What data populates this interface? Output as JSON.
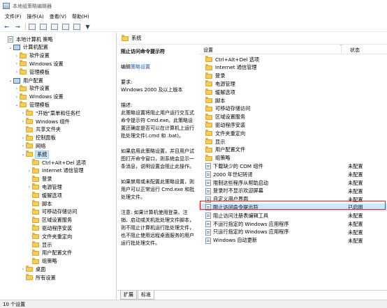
{
  "window": {
    "title": "本地组策略编辑器"
  },
  "menu": [
    "文件(F)",
    "操作(A)",
    "查看(V)",
    "帮助(H)"
  ],
  "tree": [
    {
      "label": "本地计算机 策略",
      "indent": 0,
      "twisty": "",
      "icon": "doc"
    },
    {
      "label": "计算机配置",
      "indent": 1,
      "twisty": "v",
      "icon": "pc"
    },
    {
      "label": "软件设置",
      "indent": 2,
      "twisty": ">",
      "icon": "folder"
    },
    {
      "label": "Windows 设置",
      "indent": 2,
      "twisty": ">",
      "icon": "folder"
    },
    {
      "label": "管理模板",
      "indent": 2,
      "twisty": ">",
      "icon": "folder"
    },
    {
      "label": "用户配置",
      "indent": 1,
      "twisty": "v",
      "icon": "pc"
    },
    {
      "label": "软件设置",
      "indent": 2,
      "twisty": ">",
      "icon": "folder"
    },
    {
      "label": "Windows 设置",
      "indent": 2,
      "twisty": ">",
      "icon": "folder"
    },
    {
      "label": "管理模板",
      "indent": 2,
      "twisty": "v",
      "icon": "folder"
    },
    {
      "label": "\"开始\"菜单和任务栏",
      "indent": 3,
      "twisty": ">",
      "icon": "folder"
    },
    {
      "label": "Windows 组件",
      "indent": 3,
      "twisty": ">",
      "icon": "folder"
    },
    {
      "label": "共享文件夹",
      "indent": 3,
      "twisty": "",
      "icon": "folder"
    },
    {
      "label": "控制面板",
      "indent": 3,
      "twisty": ">",
      "icon": "folder"
    },
    {
      "label": "网络",
      "indent": 3,
      "twisty": ">",
      "icon": "folder"
    },
    {
      "label": "系统",
      "indent": 3,
      "twisty": "v",
      "icon": "folder",
      "selected": true
    },
    {
      "label": "Ctrl+Alt+Del 选项",
      "indent": 4,
      "twisty": "",
      "icon": "folder"
    },
    {
      "label": "Internet 通信管理",
      "indent": 4,
      "twisty": ">",
      "icon": "folder"
    },
    {
      "label": "登录",
      "indent": 4,
      "twisty": "",
      "icon": "folder"
    },
    {
      "label": "电源管理",
      "indent": 4,
      "twisty": ">",
      "icon": "folder"
    },
    {
      "label": "缓解选项",
      "indent": 4,
      "twisty": "",
      "icon": "folder"
    },
    {
      "label": "脚本",
      "indent": 4,
      "twisty": "",
      "icon": "folder"
    },
    {
      "label": "可移动存储访问",
      "indent": 4,
      "twisty": "",
      "icon": "folder"
    },
    {
      "label": "区域设置服务",
      "indent": 4,
      "twisty": "",
      "icon": "folder"
    },
    {
      "label": "驱动程序安装",
      "indent": 4,
      "twisty": "",
      "icon": "folder"
    },
    {
      "label": "文件夹重定向",
      "indent": 4,
      "twisty": "",
      "icon": "folder"
    },
    {
      "label": "显示",
      "indent": 4,
      "twisty": "",
      "icon": "folder"
    },
    {
      "label": "用户配置文件",
      "indent": 4,
      "twisty": "",
      "icon": "folder"
    },
    {
      "label": "组策略",
      "indent": 4,
      "twisty": "",
      "icon": "folder"
    },
    {
      "label": "桌面",
      "indent": 3,
      "twisty": ">",
      "icon": "folder"
    },
    {
      "label": "所有设置",
      "indent": 3,
      "twisty": "",
      "icon": "folder"
    }
  ],
  "details": {
    "header": "系统",
    "desc_title": "阻止访问命令提示符",
    "edit_prefix": "编辑",
    "edit_link": "策略设置",
    "requirements_label": "要求:",
    "requirements": "Windows 2000 及以上版本",
    "description_label": "描述:",
    "description": "此策略设置将阻止用户运行交互式命令提示符 Cmd.exe。此策略设置还确定是否可以在计算机上运行批处理文件(.cmd 和 .bat)。",
    "enabled_text": "如果启用此策略设置，并且用户试图打开命令窗口，则系统会显示一条消息，说明设置会阻止此操作。",
    "disabled_text": "如果禁用或未配置此策略设置，则用户可以正常运行 Cmd.exe 和批处理文件。",
    "note_text": "注意: 如果计算机使用登录、注销、启动或关机批处理文件脚本，则不阻止计算机运行批处理文件，也不阻止使用远程桌面服务的用户运行批处理文件。"
  },
  "list": {
    "col_setting": "设置",
    "col_state": "状态",
    "rows": [
      {
        "label": "Ctrl+Alt+Del 选项",
        "icon": "folder",
        "state": ""
      },
      {
        "label": "Internet 通信管理",
        "icon": "folder",
        "state": ""
      },
      {
        "label": "登录",
        "icon": "folder",
        "state": ""
      },
      {
        "label": "电源管理",
        "icon": "folder",
        "state": ""
      },
      {
        "label": "缓解选项",
        "icon": "folder",
        "state": ""
      },
      {
        "label": "脚本",
        "icon": "folder",
        "state": ""
      },
      {
        "label": "可移动存储访问",
        "icon": "folder",
        "state": ""
      },
      {
        "label": "区域设置服务",
        "icon": "folder",
        "state": ""
      },
      {
        "label": "驱动程序安装",
        "icon": "folder",
        "state": ""
      },
      {
        "label": "文件夹重定向",
        "icon": "folder",
        "state": ""
      },
      {
        "label": "显示",
        "icon": "folder",
        "state": ""
      },
      {
        "label": "用户配置文件",
        "icon": "folder",
        "state": ""
      },
      {
        "label": "组策略",
        "icon": "folder",
        "state": ""
      },
      {
        "label": "下载缺少的 COM 组件",
        "icon": "doc",
        "state": "未配置"
      },
      {
        "label": "2000 年世纪转译",
        "icon": "doc",
        "state": "未配置"
      },
      {
        "label": "限制这些程序从帮助启动",
        "icon": "doc",
        "state": "未配置"
      },
      {
        "label": "登录时不显示欢迎屏幕",
        "icon": "doc",
        "state": "未配置"
      },
      {
        "label": "自定义用户界面",
        "icon": "doc",
        "state": "未配置"
      },
      {
        "label": "阻止访问命令提示符",
        "icon": "doc",
        "state": "已启用",
        "highlight": true
      },
      {
        "label": "阻止访问注册表编辑工具",
        "icon": "doc",
        "state": "未配置"
      },
      {
        "label": "不运行指定的 Windows 应用程序",
        "icon": "doc",
        "state": "未配置"
      },
      {
        "label": "只运行指定的 Windows 应用程序",
        "icon": "doc",
        "state": "未配置"
      },
      {
        "label": "Windows 自动更新",
        "icon": "doc",
        "state": "未配置"
      }
    ]
  },
  "tabs": [
    "扩展",
    "标准"
  ],
  "status": "10 个设置"
}
